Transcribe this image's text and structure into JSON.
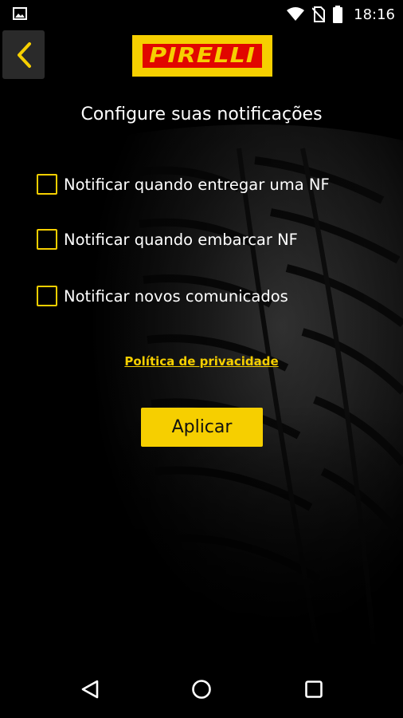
{
  "status_bar": {
    "time": "18:16",
    "icons": [
      "image-icon",
      "wifi-icon",
      "no-sim-icon",
      "battery-icon"
    ]
  },
  "header": {
    "back_icon": "chevron-left-icon",
    "logo_text": "PIRELLI"
  },
  "title": "Configure suas notificações",
  "options": [
    {
      "label": "Notificar quando entregar uma NF",
      "checked": false
    },
    {
      "label": "Notificar quando embarcar NF",
      "checked": false
    },
    {
      "label": "Notificar novos comunicados",
      "checked": false
    }
  ],
  "privacy_link": "Política de privacidade",
  "apply_button": "Aplicar",
  "nav_bar": {
    "icons": [
      "back-triangle-icon",
      "home-circle-icon",
      "recents-square-icon"
    ]
  },
  "colors": {
    "accent": "#f6cf00",
    "logo_red": "#e10600",
    "background": "#000000"
  }
}
